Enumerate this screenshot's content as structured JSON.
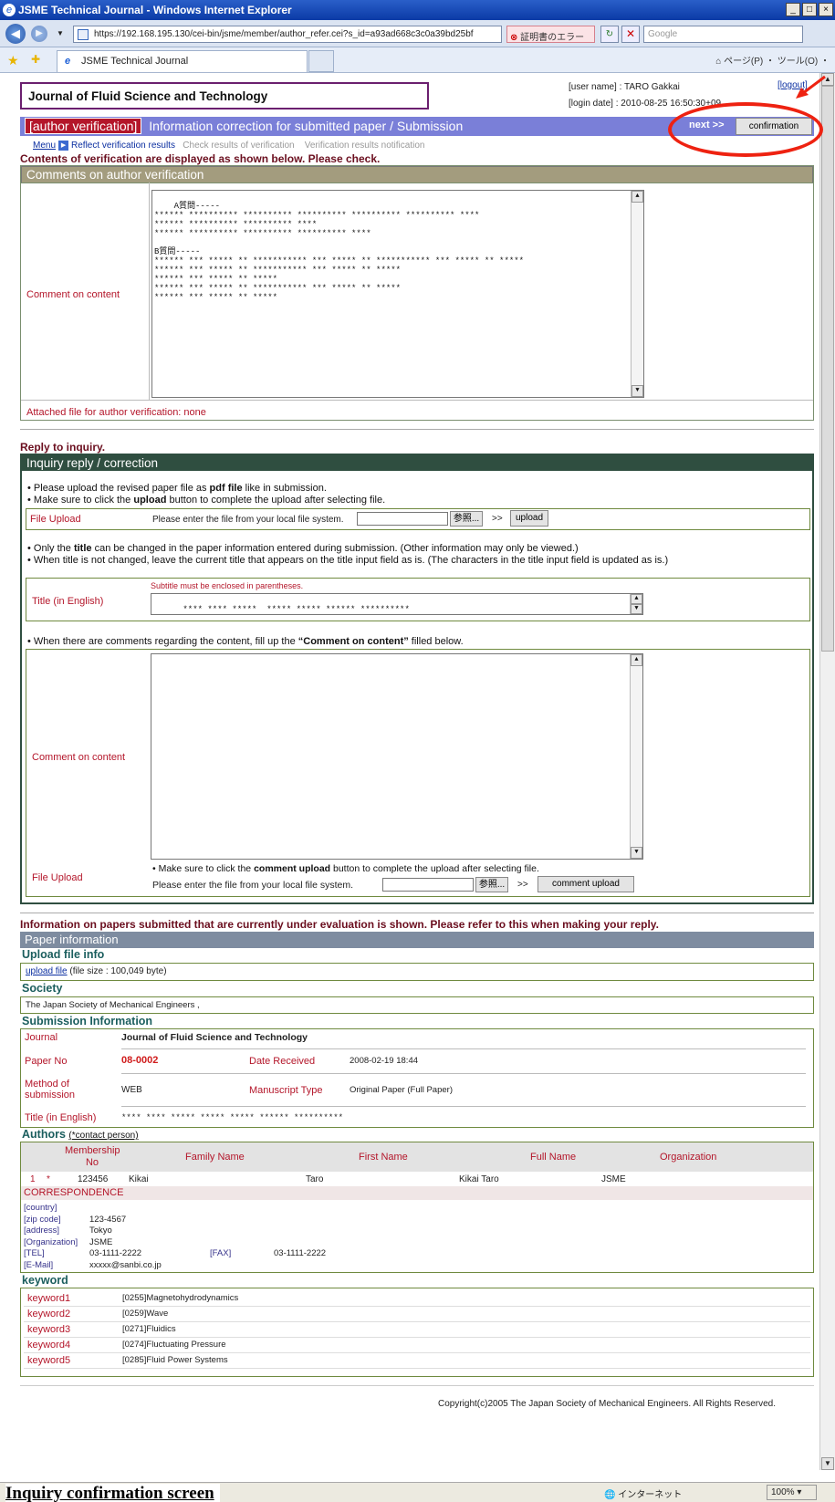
{
  "window": {
    "title": "JSME Technical Journal - Windows Internet Explorer",
    "controls": [
      "_",
      "□",
      "×"
    ]
  },
  "nav": {
    "url": "https://192.168.195.130/cei-bin/jsme/member/author_refer.cei?s_id=a93ad668c3c0a39bd25bf",
    "cert_error": "証明書のエラー",
    "search_placeholder": "Google",
    "tab_title": "JSME Technical Journal",
    "commands": "ページ(P) ・ ツール(O) ・"
  },
  "header": {
    "journal": "Journal of Fluid Science and Technology",
    "user_name": "[user name] : TARO Gakkai",
    "login_date": "[login date] : 2010-08-25 16:50:30+09",
    "logout": "[logout]",
    "badge": "[author verification]",
    "title": "Information correction for submitted paper / Submission",
    "next": "next >>",
    "confirmation": "confirmation"
  },
  "breadcrumb": {
    "menu": "Menu",
    "step1": "Reflect verification results",
    "step2": "Check results of verification",
    "step3": "Verification results notification"
  },
  "verification": {
    "intro": "Contents of verification are displayed as shown below. Please check.",
    "section_title": "Comments on author verification",
    "comment_label": "Comment on content",
    "comment_text": "A質問-----\n****** ********** ********** ********** ********** ********** ****\n****** ********** ********** ****\n****** ********** ********** ********** ****\n\nB質問-----\n****** *** ***** ** *********** *** ***** ** *********** *** ***** ** *****\n****** *** ***** ** *********** *** ***** ** *****\n****** *** ***** ** *****\n****** *** ***** ** *********** *** ***** ** *****\n****** *** ***** ** *****",
    "attached": "Attached file for author verification: none"
  },
  "reply": {
    "heading": "Reply to inquiry.",
    "section_title": "Inquiry reply / correction",
    "bullet1_a": "Please upload the revised paper file as ",
    "bullet1_b": "pdf file",
    "bullet1_c": " like in submission.",
    "bullet2_a": "Make sure to click the ",
    "bullet2_b": "upload",
    "bullet2_c": " button to complete the upload after selecting file.",
    "file_upload_label": "File Upload",
    "file_prompt": "Please enter the file from your local file system.",
    "browse": "参照...",
    "arrows": ">>",
    "upload": "upload",
    "bullet3_a": "Only the ",
    "bullet3_b": "title",
    "bullet3_c": " can be changed in the paper information entered during submission. (Other information may only be viewed.)",
    "bullet4": "When title is not changed, leave the current title that appears on the title input field as is. (The characters in the title input field is updated as is.)",
    "subtitle_note": "Subtitle must be enclosed in parentheses.",
    "title_label": "Title (in English)",
    "title_value": "**** **** *****  ***** ***** ****** **********",
    "bullet5_a": "When there are comments regarding the content, fill up the ",
    "bullet5_b": "“Comment on content”",
    "bullet5_c": " filled below.",
    "comment_label": "Comment on content",
    "comment_upload_a": "Make sure to click the ",
    "comment_upload_b": "comment upload",
    "comment_upload_c": " button to complete the upload after selecting file.",
    "comment_file_label": "File Upload",
    "comment_upload_btn": "comment upload"
  },
  "paper": {
    "intro": "Information on papers submitted that are currently under evaluation is shown. Please refer to this when making your reply.",
    "section_title": "Paper information",
    "upload_info_title": "Upload file info",
    "upload_link": "upload file",
    "file_size": "(file size : 100,049 byte)",
    "society_title": "Society",
    "society": "The Japan Society of Mechanical Engineers ,",
    "submission_title": "Submission Information",
    "journal_label": "Journal",
    "journal_value": "Journal of Fluid Science and Technology",
    "paper_no_label": "Paper No",
    "paper_no": "08-0002",
    "date_label": "Date Received",
    "date_value": "2008-02-19 18:44",
    "method_label_1": "Method of",
    "method_label_2": "submission",
    "method_value": "WEB",
    "ms_type_label": "Manuscript Type",
    "ms_type_value": "Original Paper (Full Paper)",
    "title_label": "Title (in English)",
    "title_value": "**** **** ***** ***** ***** ****** **********",
    "authors_title": "Authors",
    "contact_note": "(*contact person)",
    "author_headers": [
      "Membership No",
      "Family Name",
      "First Name",
      "Full Name",
      "Organization"
    ],
    "author_row": {
      "num": "1",
      "star": "*",
      "membership": "123456",
      "family": "Kikai",
      "first": "Taro",
      "full": "Kikai Taro",
      "org": "JSME"
    },
    "correspondence": "CORRESPONDENCE",
    "corr": {
      "country_label": "[country]",
      "zip_label": "[zip code]",
      "zip": "123-4567",
      "address_label": "[address]",
      "address": "Tokyo",
      "org_label": "[Organization]",
      "org": "JSME",
      "tel_label": "[TEL]",
      "tel": "03-1111-2222",
      "fax_label": "[FAX]",
      "fax": "03-1111-2222",
      "email_label": "[E-Mail]",
      "email": "xxxxx@sanbi.co.jp"
    },
    "keyword_title": "keyword",
    "keywords": [
      {
        "label": "keyword1",
        "value": "[0255]Magnetohydrodynamics"
      },
      {
        "label": "keyword2",
        "value": "[0259]Wave"
      },
      {
        "label": "keyword3",
        "value": "[0271]Fluidics"
      },
      {
        "label": "keyword4",
        "value": "[0274]Fluctuating Pressure"
      },
      {
        "label": "keyword5",
        "value": "[0285]Fluid Power Systems"
      }
    ]
  },
  "footer": {
    "copyright": "Copyright(c)2005 The Japan Society of Mechanical Engineers. All Rights Reserved."
  },
  "status": {
    "zone": "インターネット",
    "zoom": "100%"
  },
  "caption": "Inquiry confirmation screen",
  "colors": {
    "accent_purple": "#7a7fd8",
    "badge_red": "#b4162a",
    "annotation_red": "#e21"
  }
}
